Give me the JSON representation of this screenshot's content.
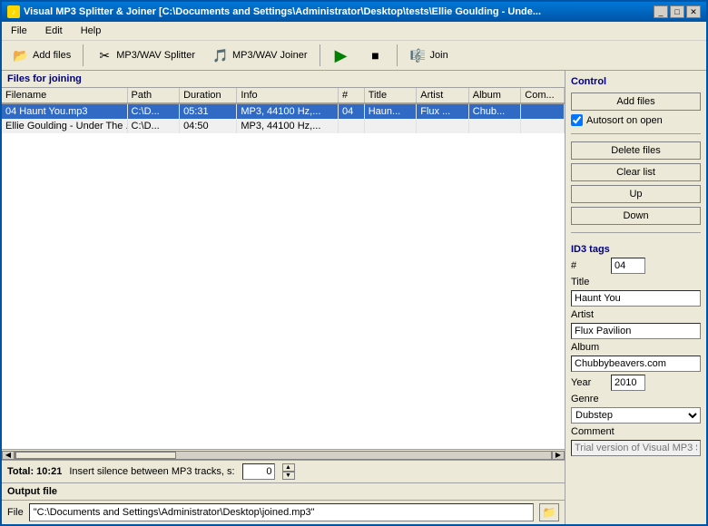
{
  "window": {
    "title": "Visual MP3 Splitter & Joiner [C:\\Documents and Settings\\Administrator\\Desktop\\tests\\Ellie Goulding - Unde...",
    "icon": "♪"
  },
  "menu": {
    "items": [
      "File",
      "Edit",
      "Help"
    ]
  },
  "toolbar": {
    "add_files": "Add files",
    "splitter": "MP3/WAV Splitter",
    "joiner": "MP3/WAV Joiner",
    "join": "Join"
  },
  "files_section": {
    "header": "Files for joining",
    "columns": [
      "Filename",
      "Path",
      "Duration",
      "Info",
      "#",
      "Title",
      "Artist",
      "Album",
      "Com..."
    ],
    "rows": [
      {
        "filename": "04 Haunt You.mp3",
        "path": "C:\\D...",
        "duration": "05:31",
        "info": "MP3, 44100 Hz,...",
        "number": "04",
        "title": "Haun...",
        "artist": "Flux ...",
        "album": "Chub...",
        "comment": ""
      },
      {
        "filename": "Ellie Goulding - Under The ...",
        "path": "C:\\D...",
        "duration": "04:50",
        "info": "MP3, 44100 Hz,...",
        "number": "",
        "title": "",
        "artist": "",
        "album": "",
        "comment": ""
      }
    ]
  },
  "status": {
    "total": "Total: 10:21",
    "silence_label": "Insert silence between MP3 tracks, s:",
    "silence_value": "0"
  },
  "output": {
    "label": "Output file",
    "file_label": "File",
    "file_value": "\"C:\\Documents and Settings\\Administrator\\Desktop\\joined.mp3\""
  },
  "control": {
    "title": "Control",
    "add_files": "Add files",
    "autosort": "Autosort on open",
    "delete_files": "Delete files",
    "clear_list": "Clear list",
    "up": "Up",
    "down": "Down"
  },
  "id3": {
    "title": "ID3 tags",
    "number_label": "#",
    "number_value": "04",
    "title_label": "Title",
    "title_value": "Haunt You",
    "artist_label": "Artist",
    "artist_value": "Flux Pavilion",
    "album_label": "Album",
    "album_value": "Chubbybeavers.com",
    "year_label": "Year",
    "year_value": "2010",
    "genre_label": "Genre",
    "genre_value": "Dubstep",
    "comment_label": "Comment",
    "comment_placeholder": "Trial version of Visual MP3 S"
  }
}
